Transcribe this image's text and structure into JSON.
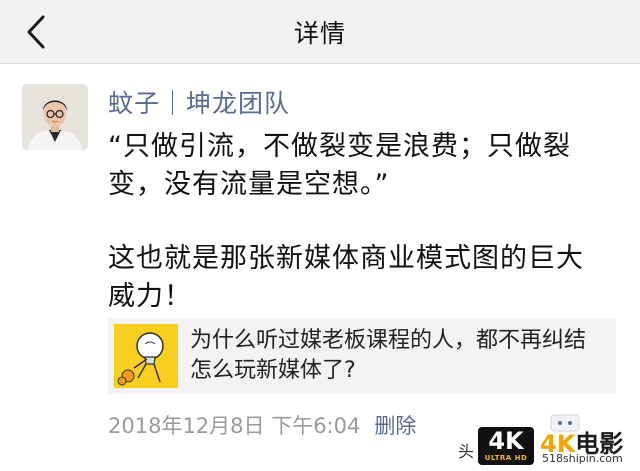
{
  "navbar": {
    "title": "详情",
    "back_icon": "chevron-left-icon"
  },
  "post": {
    "author": "蚊子｜坤龙团队",
    "paragraphs": [
      "“只做引流，不做裂变是浪费；只做裂变，没有流量是空想。”",
      "这也就是那张新媒体商业模式图的巨大威力！"
    ],
    "link_card": {
      "title": "为什么听过媒老板课程的人，都不再纠结怎么玩新媒体了?",
      "thumb_color": "#f8cf1e"
    },
    "timestamp": "2018年12月8日 下午6:04",
    "delete_label": "删除"
  },
  "watermark": {
    "tou": "头",
    "badge_big": "4K",
    "badge_small": "ULTRA HD",
    "brand_k": "4K",
    "brand_rest": "电影",
    "url": "518shipin.com"
  },
  "colors": {
    "link_blue": "#566c92",
    "navbar_bg": "#f2f2f2",
    "meta_gray": "#9a9a9a"
  }
}
